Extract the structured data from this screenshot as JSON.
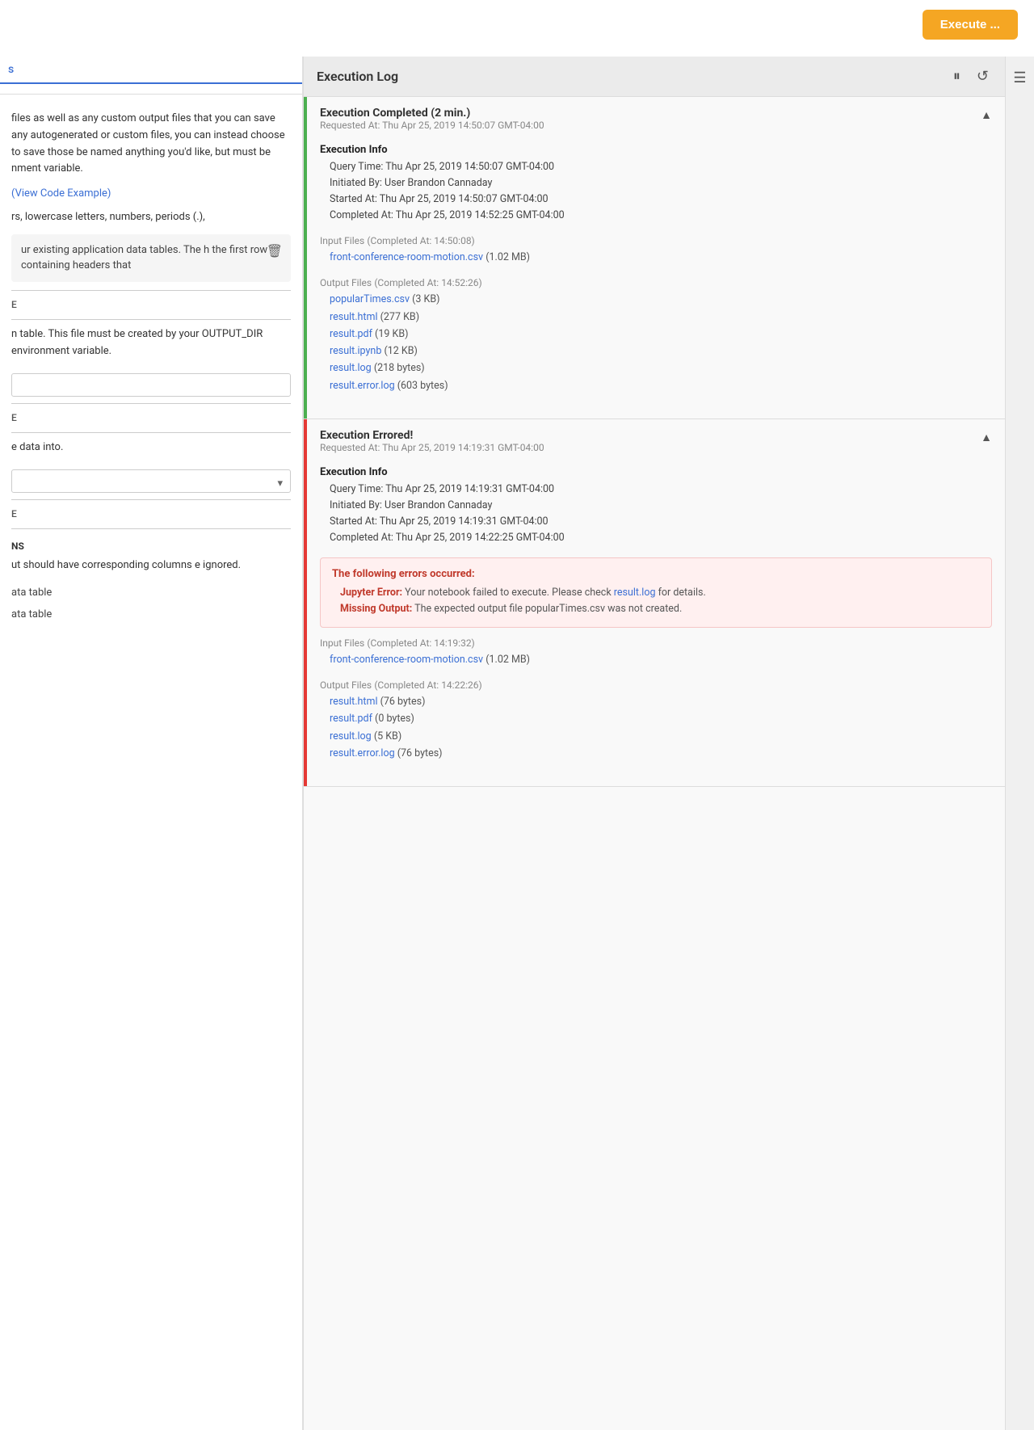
{
  "topbar": {
    "execute_label": "Execute ..."
  },
  "left_panel": {
    "nav_label": "s",
    "text_blocks": [
      "files as well as any custom output files that you can save any autogenerated or custom files, you can instead choose to save those be named anything you'd like, but must be nment variable.",
      "(View Code Example)"
    ],
    "letters_hint": "rs, lowercase letters, numbers, periods (.),",
    "input_section_text": "ur existing application data tables. The h the first row containing headers that",
    "label_e1": "E",
    "text_table": "n table. This file must be created by your OUTPUT_DIR environment variable.",
    "label_e2": "E",
    "text_into": "e data into.",
    "label_e3": "E",
    "section_ns": "NS",
    "text_cols": "ut should have corresponding columns e ignored.",
    "data_table_1": "ata table",
    "data_table_2": "ata table"
  },
  "execution_log": {
    "title": "Execution Log",
    "entries": [
      {
        "id": "entry-success",
        "title": "Execution Completed (2 min.)",
        "requested_at": "Requested At: Thu Apr 25, 2019 14:50:07 GMT-04:00",
        "status": "success",
        "info": {
          "title": "Execution Info",
          "rows": [
            "Query Time: Thu Apr 25, 2019 14:50:07 GMT-04:00",
            "Initiated By: User Brandon Cannaday",
            "Started At: Thu Apr 25, 2019 14:50:07 GMT-04:00",
            "Completed At: Thu Apr 25, 2019 14:52:25 GMT-04:00"
          ]
        },
        "input_files": {
          "title": "Input Files",
          "completed_at": "(Completed At: 14:50:08)",
          "files": [
            {
              "name": "front-conference-room-motion.csv",
              "size": "(1.02 MB)"
            }
          ]
        },
        "output_files": {
          "title": "Output Files",
          "completed_at": "(Completed At: 14:52:26)",
          "files": [
            {
              "name": "popularTimes.csv",
              "size": "(3 KB)"
            },
            {
              "name": "result.html",
              "size": "(277 KB)"
            },
            {
              "name": "result.pdf",
              "size": "(19 KB)"
            },
            {
              "name": "result.ipynb",
              "size": "(12 KB)"
            },
            {
              "name": "result.log",
              "size": "(218 bytes)"
            },
            {
              "name": "result.error.log",
              "size": "(603 bytes)"
            }
          ]
        }
      },
      {
        "id": "entry-error",
        "title": "Execution Errored!",
        "requested_at": "Requested At: Thu Apr 25, 2019 14:19:31 GMT-04:00",
        "status": "error",
        "info": {
          "title": "Execution Info",
          "rows": [
            "Query Time: Thu Apr 25, 2019 14:19:31 GMT-04:00",
            "Initiated By: User Brandon Cannaday",
            "Started At: Thu Apr 25, 2019 14:19:31 GMT-04:00",
            "Completed At: Thu Apr 25, 2019 14:22:25 GMT-04:00"
          ]
        },
        "error": {
          "title": "The following errors occurred:",
          "lines": [
            {
              "label": "Jupyter Error:",
              "text": " Your notebook failed to execute. Please check ",
              "link": "result.log",
              "suffix": " for details."
            },
            {
              "label": "Missing Output:",
              "text": " The expected output file popularTimes.csv was not created.",
              "link": "",
              "suffix": ""
            }
          ]
        },
        "input_files": {
          "title": "Input Files",
          "completed_at": "(Completed At: 14:19:32)",
          "files": [
            {
              "name": "front-conference-room-motion.csv",
              "size": "(1.02 MB)"
            }
          ]
        },
        "output_files": {
          "title": "Output Files",
          "completed_at": "(Completed At: 14:22:26)",
          "files": [
            {
              "name": "result.html",
              "size": "(76 bytes)"
            },
            {
              "name": "result.pdf",
              "size": "(0 bytes)"
            },
            {
              "name": "result.log",
              "size": "(5 KB)"
            },
            {
              "name": "result.error.log",
              "size": "(76 bytes)"
            }
          ]
        }
      }
    ]
  },
  "colors": {
    "success_bar": "#4caf50",
    "error_bar": "#e53935",
    "link": "#3b6fd4",
    "execute_btn": "#f5a623"
  }
}
